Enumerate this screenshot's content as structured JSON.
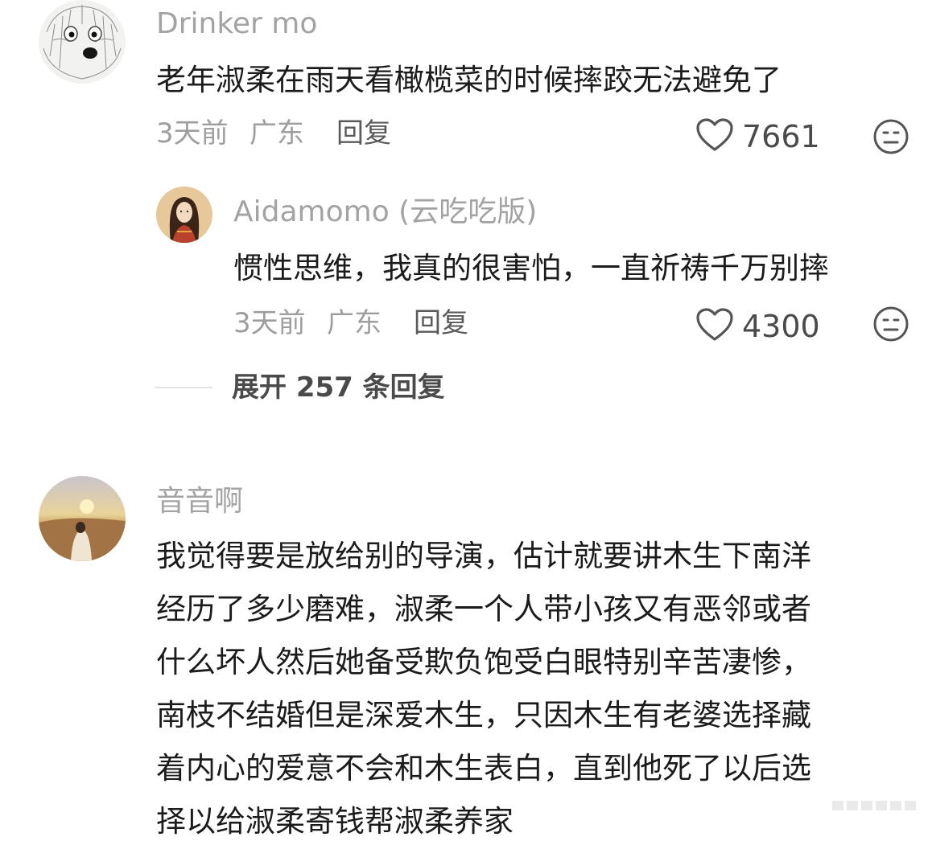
{
  "comments": [
    {
      "username": "Drinker mo",
      "text": "老年淑柔在雨天看橄榄菜的时候摔跤无法避免了",
      "time": "3天前",
      "location": "广东",
      "reply_label": "回复",
      "likes": "7661",
      "avatar": "dog-avatar"
    },
    {
      "username": "Aidamomo (云吃吃版)",
      "text": "惯性思维，我真的很害怕，一直祈祷千万别摔",
      "time": "3天前",
      "location": "广东",
      "reply_label": "回复",
      "likes": "4300",
      "avatar": "girl-avatar"
    },
    {
      "username": "音音啊",
      "text_lines": [
        "我觉得要是放给别的导演，估计就要讲木生下南洋",
        "经历了多少磨难，淑柔一个人带小孩又有恶邻或者",
        "什么坏人然后她备受欺负饱受白眼特别辛苦凄惨，",
        "南枝不结婚但是深爱木生，只因木生有老婆选择藏",
        "着内心的爱意不会和木生表白，直到他死了以后选",
        "择以给淑柔寄钱帮淑柔养家"
      ],
      "avatar": "sunset-avatar"
    }
  ],
  "expand_replies": "展开 257 条回复",
  "colors": {
    "username": "#a3a3a3",
    "text": "#1b1b1b",
    "meta": "#9e9e9e"
  }
}
